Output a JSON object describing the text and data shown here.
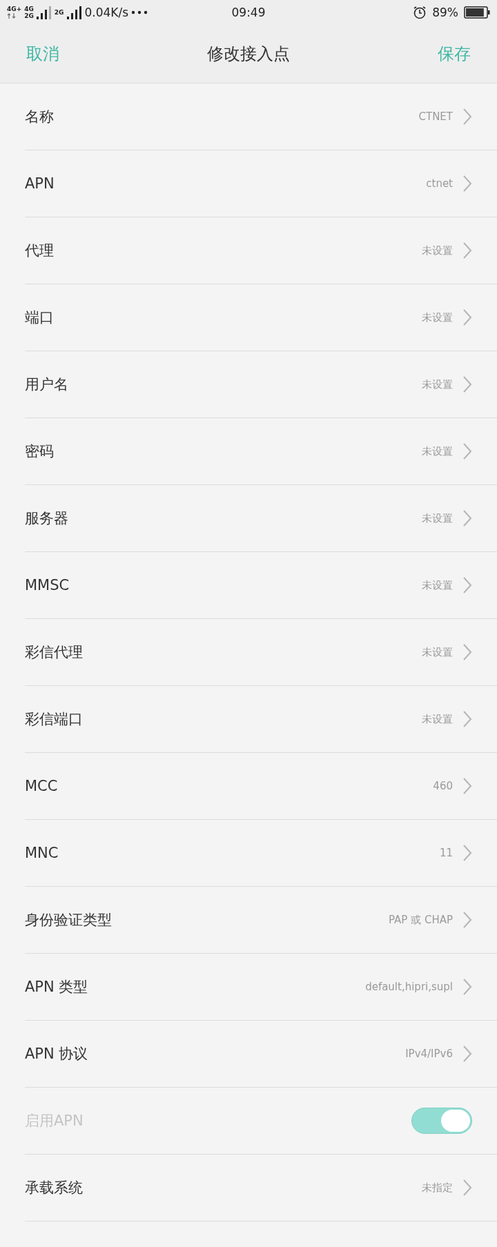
{
  "status_bar": {
    "network_labels": [
      "4G+",
      "4G",
      "2G",
      "2G"
    ],
    "speed": "0.04K/s",
    "time": "09:49",
    "battery": "89%"
  },
  "header": {
    "cancel": "取消",
    "title": "修改接入点",
    "save": "保存"
  },
  "settings": [
    {
      "kind": "link",
      "label": "名称",
      "value": "CTNET",
      "disabled": false
    },
    {
      "kind": "link",
      "label": "APN",
      "value": "ctnet",
      "disabled": false
    },
    {
      "kind": "link",
      "label": "代理",
      "value": "未设置",
      "disabled": false
    },
    {
      "kind": "link",
      "label": "端口",
      "value": "未设置",
      "disabled": false
    },
    {
      "kind": "link",
      "label": "用户名",
      "value": "未设置",
      "disabled": false
    },
    {
      "kind": "link",
      "label": "密码",
      "value": "未设置",
      "disabled": false
    },
    {
      "kind": "link",
      "label": "服务器",
      "value": "未设置",
      "disabled": false
    },
    {
      "kind": "link",
      "label": "MMSC",
      "value": "未设置",
      "disabled": false
    },
    {
      "kind": "link",
      "label": "彩信代理",
      "value": "未设置",
      "disabled": false
    },
    {
      "kind": "link",
      "label": "彩信端口",
      "value": "未设置",
      "disabled": false
    },
    {
      "kind": "link",
      "label": "MCC",
      "value": "460",
      "disabled": false
    },
    {
      "kind": "link",
      "label": "MNC",
      "value": "11",
      "disabled": false
    },
    {
      "kind": "link",
      "label": "身份验证类型",
      "value": "PAP 或 CHAP",
      "disabled": false
    },
    {
      "kind": "link",
      "label": "APN 类型",
      "value": "default,hipri,supl",
      "disabled": false
    },
    {
      "kind": "link",
      "label": "APN 协议",
      "value": "IPv4/IPv6",
      "disabled": false
    },
    {
      "kind": "toggle",
      "label": "启用APN",
      "on": true,
      "disabled": true
    },
    {
      "kind": "link",
      "label": "承载系统",
      "value": "未指定",
      "disabled": false
    }
  ]
}
